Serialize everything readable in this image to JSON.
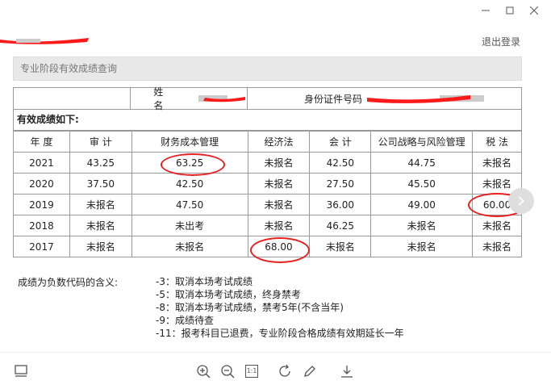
{
  "header": {
    "logout": "退出登录"
  },
  "query_title": "专业阶段有效成绩查询",
  "info": {
    "name_label": "姓　　名",
    "id_label": "身份证件号码"
  },
  "valid_label": "有效成绩如下:",
  "table": {
    "headers": [
      "年 度",
      "审 计",
      "财务成本管理",
      "经济法",
      "会 计",
      "公司战略与风险管理",
      "税 法"
    ],
    "rows": [
      [
        "2021",
        "43.25",
        "63.25",
        "未报名",
        "42.50",
        "44.75",
        "未报名"
      ],
      [
        "2020",
        "37.50",
        "42.50",
        "未报名",
        "27.50",
        "45.50",
        "未报名"
      ],
      [
        "2019",
        "未报名",
        "47.50",
        "未报名",
        "36.00",
        "49.00",
        "60.00"
      ],
      [
        "2018",
        "未报名",
        "未出考",
        "未报名",
        "46.25",
        "未报名",
        "未报名"
      ],
      [
        "2017",
        "未报名",
        "未报名",
        "68.00",
        "未报名",
        "未报名",
        "未报名"
      ]
    ]
  },
  "codes": {
    "title": "成绩为负数代码的含义:",
    "items": [
      "-3：取消本场考试成绩",
      "-5：取消本场考试成绩，终身禁考",
      "-8：取消本场考试成绩，禁考5年(不含当年)",
      "-9：成绩待查",
      "-11：报考科目已退费，专业阶段合格成绩有效期延长一年"
    ]
  },
  "toolbar": {
    "actual_size": "1:1"
  },
  "icons": [
    "minimize-icon",
    "maximize-icon",
    "close-icon",
    "thumbnail-icon",
    "zoom-in-icon",
    "zoom-out-icon",
    "actual-size-icon",
    "rotate-icon",
    "edit-icon",
    "download-icon",
    "chevron-right-icon"
  ],
  "colors": {
    "annotation": "#e82020",
    "redaction": "#ff1a1a",
    "header_bar": "#e8e8e8"
  }
}
